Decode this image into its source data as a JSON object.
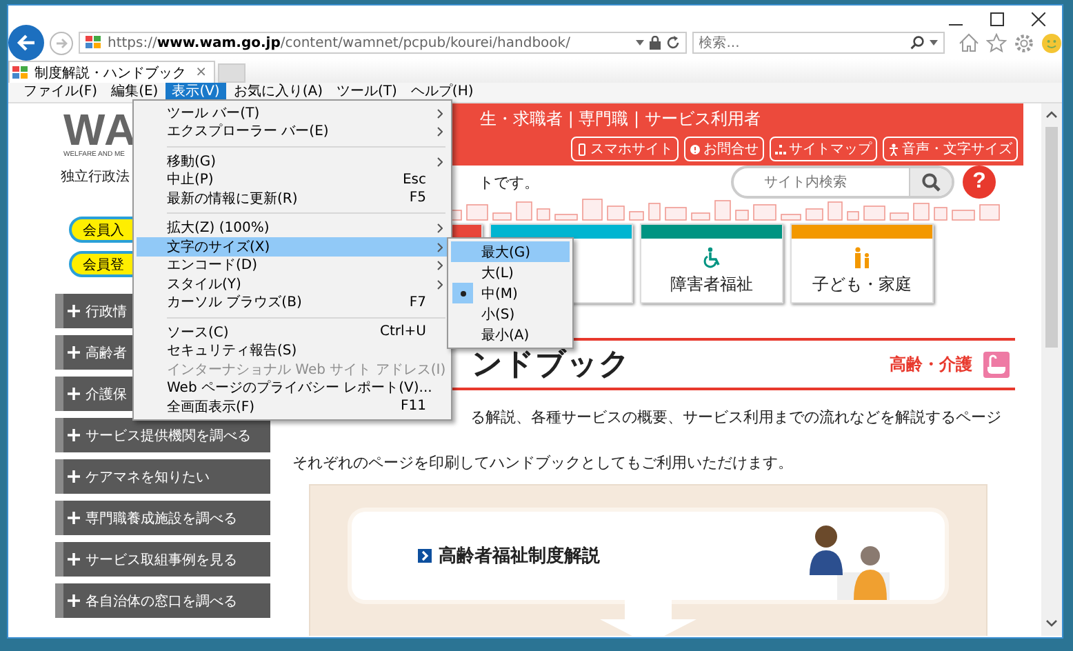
{
  "address_bar": {
    "url": "https://**www.wam.go.jp**/content/wamnet/pcpub/kourei/handbook/"
  },
  "search_box": {
    "placeholder": "検索..."
  },
  "tabs": [
    {
      "title": "制度解説・ハンドブック",
      "close": "×",
      "selected": true
    }
  ],
  "menu_bar": [
    {
      "label": "ファイル(F)",
      "selected": false
    },
    {
      "label": "編集(E)",
      "selected": false
    },
    {
      "label": "表示(V)",
      "selected": true
    },
    {
      "label": "お気に入り(A)",
      "selected": false
    },
    {
      "label": "ツール(T)",
      "selected": false
    },
    {
      "label": "ヘルプ(H)",
      "selected": false
    }
  ],
  "open_menu": {
    "items": [
      {
        "kind": "item",
        "label": "ツール バー(T)",
        "submenu": true,
        "highlighted": false,
        "disabled": false
      },
      {
        "kind": "item",
        "label": "エクスプローラー バー(E)",
        "submenu": true,
        "highlighted": false,
        "disabled": false
      },
      {
        "kind": "separator"
      },
      {
        "kind": "item",
        "label": "移動(G)",
        "submenu": true,
        "highlighted": false,
        "disabled": false
      },
      {
        "kind": "item",
        "label": "中止(P)",
        "shortcut": "Esc",
        "submenu": false,
        "highlighted": false,
        "disabled": false
      },
      {
        "kind": "item",
        "label": "最新の情報に更新(R)",
        "shortcut": "F5",
        "submenu": false,
        "highlighted": false,
        "disabled": false
      },
      {
        "kind": "separator"
      },
      {
        "kind": "item",
        "label": "拡大(Z) (100%)",
        "submenu": true,
        "highlighted": false,
        "disabled": false
      },
      {
        "kind": "item",
        "label": "文字のサイズ(X)",
        "submenu": true,
        "highlighted": true,
        "disabled": false
      },
      {
        "kind": "item",
        "label": "エンコード(D)",
        "submenu": true,
        "highlighted": false,
        "disabled": false
      },
      {
        "kind": "item",
        "label": "スタイル(Y)",
        "submenu": true,
        "highlighted": false,
        "disabled": false
      },
      {
        "kind": "item",
        "label": "カーソル ブラウズ(B)",
        "shortcut": "F7",
        "submenu": false,
        "highlighted": false,
        "disabled": false
      },
      {
        "kind": "separator"
      },
      {
        "kind": "item",
        "label": "ソース(C)",
        "shortcut": "Ctrl+U",
        "submenu": false,
        "highlighted": false,
        "disabled": false
      },
      {
        "kind": "item",
        "label": "セキュリティ報告(S)",
        "submenu": false,
        "highlighted": false,
        "disabled": false
      },
      {
        "kind": "item",
        "label": "インターナショナル Web サイト アドレス(I)",
        "submenu": false,
        "highlighted": false,
        "disabled": true
      },
      {
        "kind": "item",
        "label": "Web ページのプライバシー レポート(V)...",
        "submenu": false,
        "highlighted": false,
        "disabled": false
      },
      {
        "kind": "item",
        "label": "全画面表示(F)",
        "shortcut": "F11",
        "submenu": false,
        "highlighted": false,
        "disabled": false
      }
    ]
  },
  "submenu": {
    "items": [
      {
        "kind": "item",
        "label": "最大(G)",
        "highlighted": true,
        "checked": false
      },
      {
        "kind": "item",
        "label": "大(L)",
        "highlighted": false,
        "checked": false
      },
      {
        "kind": "item",
        "label": "中(M)",
        "highlighted": false,
        "checked": true
      },
      {
        "kind": "item",
        "label": "小(S)",
        "highlighted": false,
        "checked": false
      },
      {
        "kind": "item",
        "label": "最小(A)",
        "highlighted": false,
        "checked": false
      }
    ]
  },
  "site": {
    "logo": {
      "letters": "WA",
      "caption": "WELFARE AND ME"
    },
    "header_text": "生・求職者 | 専門職 | サービス利用者",
    "header_buttons": [
      "スマホサイト",
      "お問合せ",
      "サイトマップ",
      "音声・文字サイズ"
    ],
    "intro_start": "独立行政法",
    "intro_end": "トです。",
    "site_search": {
      "placeholder": "サイト内検索"
    },
    "help": "?",
    "member_buttons": [
      "会員入",
      "会員登"
    ],
    "cards": [
      {
        "color": "#e8463a"
      },
      {
        "color": "#00b5d1"
      },
      {
        "label": "障害者福祉",
        "color": "#009482"
      },
      {
        "label": "子ども・家庭",
        "color": "#f39800"
      }
    ],
    "sidebar": [
      "行政情",
      "高齢者",
      "介護保",
      "サービス提供機関を調べる",
      "ケアマネを知りたい",
      "専門職養成施設を調べる",
      "サービス取組事例を見る",
      "各自治体の窓口を調べる"
    ],
    "heading": "ンドブック",
    "category": "高齢・介護",
    "paragraphs": [
      "る解説、各種サービスの概要、サービス利用までの流れなどを解説するページ",
      "それぞれのページを印刷してハンドブックとしてもご利用いただけます。"
    ],
    "feature_card": {
      "title": "高齢者福祉制度解説"
    }
  }
}
